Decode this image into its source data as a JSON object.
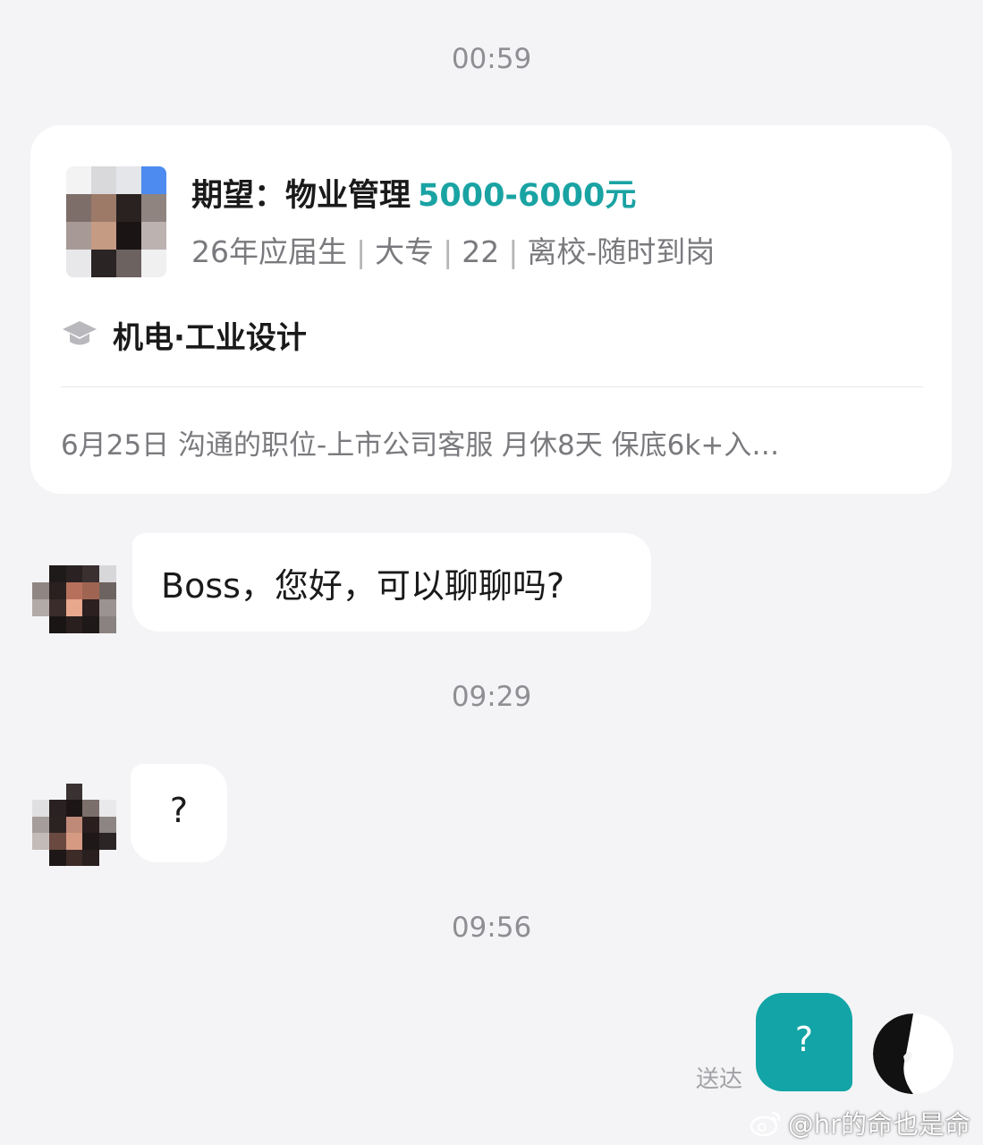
{
  "chat": {
    "timestamps": [
      "00:59",
      "09:29",
      "09:56"
    ],
    "status_delivered": "送达"
  },
  "candidate_card": {
    "expect_label": "期望：物业管理",
    "salary": "5000-6000元",
    "meta": [
      "26年应届生",
      "大专",
      "22",
      "离校-随时到岗"
    ],
    "major": "机电·工业设计",
    "footer": "6月25日 沟通的职位-上市公司客服 月休8天 保底6k+入…",
    "icons": {
      "education": "graduation-cap-icon"
    }
  },
  "messages": [
    {
      "from": "candidate",
      "text": "Boss，您好，可以聊聊吗?"
    },
    {
      "from": "candidate",
      "text": "?"
    },
    {
      "from": "me",
      "text": "?"
    }
  ],
  "colors": {
    "accent": "#12a4a6",
    "salary": "#1aa3a3",
    "background": "#f4f4f6"
  },
  "watermark": {
    "text": "@hr的命也是命",
    "icon": "weibo-icon"
  }
}
